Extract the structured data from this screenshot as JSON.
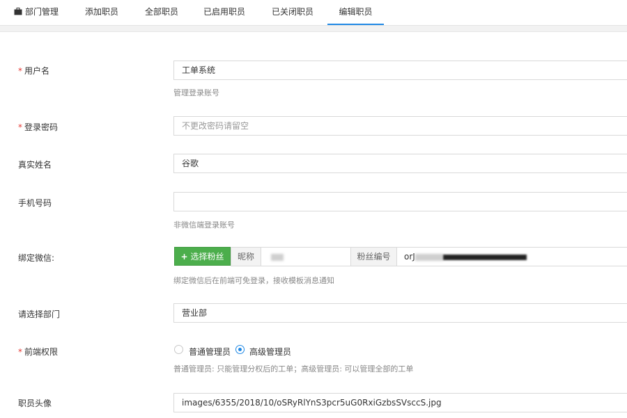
{
  "tabs": [
    {
      "label": "部门管理",
      "icon": "briefcase-icon"
    },
    {
      "label": "添加职员"
    },
    {
      "label": "全部职员"
    },
    {
      "label": "已启用职员"
    },
    {
      "label": "已关闭职员"
    },
    {
      "label": "编辑职员",
      "active": true
    }
  ],
  "form": {
    "username": {
      "label": "用户名",
      "required": true,
      "value": "工单系统",
      "help": "管理登录账号"
    },
    "password": {
      "label": "登录密码",
      "required": true,
      "placeholder": "不更改密码请留空"
    },
    "realname": {
      "label": "真实姓名",
      "value": "谷歌"
    },
    "mobile": {
      "label": "手机号码",
      "value": "",
      "help": "非微信端登录账号"
    },
    "wechat": {
      "label": "绑定微信:",
      "button_label": "选择粉丝",
      "nickname_label": "昵称",
      "fan_id_label": "粉丝编号",
      "fan_id_prefix": "orJ",
      "help": "绑定微信后在前端可免登录，接收模板消息通知"
    },
    "department": {
      "label": "请选择部门",
      "value": "营业部"
    },
    "permission": {
      "label": "前端权限",
      "required": true,
      "options": [
        "普通管理员",
        "高级管理员"
      ],
      "selected": "高级管理员",
      "help": "普通管理员: 只能管理分权后的工单；高级管理员: 可以管理全部的工单"
    },
    "avatar": {
      "label": "职员头像",
      "value": "images/6355/2018/10/oSRyRlYnS3pcr5uG0RxiGzbsSVsccS.jpg"
    }
  },
  "colors": {
    "accent": "#1e88e5",
    "success": "#4cae4c",
    "required": "#e53935"
  }
}
